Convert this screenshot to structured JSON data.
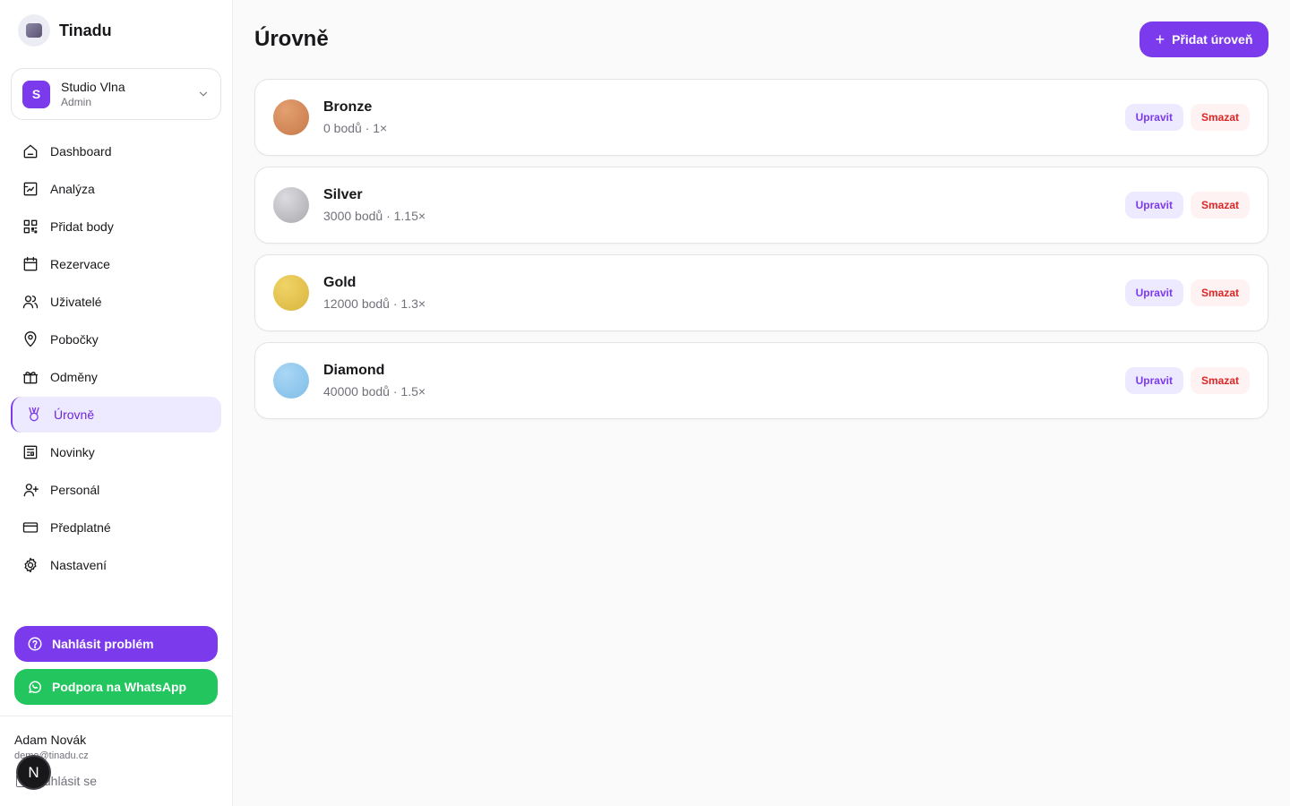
{
  "app": {
    "name": "Tinadu"
  },
  "org": {
    "initial": "S",
    "name": "Studio Vlna",
    "role": "Admin"
  },
  "nav": [
    {
      "id": "dashboard",
      "label": "Dashboard",
      "icon": "home-icon",
      "active": false
    },
    {
      "id": "analyza",
      "label": "Analýza",
      "icon": "chart-icon",
      "active": false
    },
    {
      "id": "pridat-body",
      "label": "Přidat body",
      "icon": "qr-code-icon",
      "active": false
    },
    {
      "id": "rezervace",
      "label": "Rezervace",
      "icon": "calendar-icon",
      "active": false
    },
    {
      "id": "uzivatele",
      "label": "Uživatelé",
      "icon": "users-icon",
      "active": false
    },
    {
      "id": "pobocky",
      "label": "Pobočky",
      "icon": "map-pin-icon",
      "active": false
    },
    {
      "id": "odmeny",
      "label": "Odměny",
      "icon": "gift-icon",
      "active": false
    },
    {
      "id": "urovne",
      "label": "Úrovně",
      "icon": "medal-icon",
      "active": true
    },
    {
      "id": "novinky",
      "label": "Novinky",
      "icon": "newspaper-icon",
      "active": false
    },
    {
      "id": "personal",
      "label": "Personál",
      "icon": "user-plus-icon",
      "active": false
    },
    {
      "id": "predplatne",
      "label": "Předplatné",
      "icon": "credit-card-icon",
      "active": false
    },
    {
      "id": "nastaveni",
      "label": "Nastavení",
      "icon": "gear-icon",
      "active": false
    }
  ],
  "support": {
    "report_label": "Nahlásit problém",
    "whatsapp_label": "Podpora na WhatsApp"
  },
  "user": {
    "name": "Adam Novák",
    "email": "demo@tinadu.cz",
    "logout_label": "Odhlásit se",
    "badge": "N"
  },
  "page": {
    "title": "Úrovně",
    "add_label": "Přidat úroveň"
  },
  "levels": [
    {
      "name": "Bronze",
      "meta": "0 bodů · 1×",
      "color": "#c8794a",
      "color_light": "#e3a070",
      "edit_label": "Upravit",
      "delete_label": "Smazat"
    },
    {
      "name": "Silver",
      "meta": "3000 bodů · 1.15×",
      "color": "#a8a8ad",
      "color_light": "#dcdce0",
      "edit_label": "Upravit",
      "delete_label": "Smazat"
    },
    {
      "name": "Gold",
      "meta": "12000 bodů · 1.3×",
      "color": "#d9b43c",
      "color_light": "#f0d468",
      "edit_label": "Upravit",
      "delete_label": "Smazat"
    },
    {
      "name": "Diamond",
      "meta": "40000 bodů · 1.5×",
      "color": "#7fbde8",
      "color_light": "#a9d6f5",
      "edit_label": "Upravit",
      "delete_label": "Smazat"
    }
  ],
  "colors": {
    "accent": "#7c3aed",
    "whatsapp": "#22c55e",
    "danger": "#dc2626"
  }
}
